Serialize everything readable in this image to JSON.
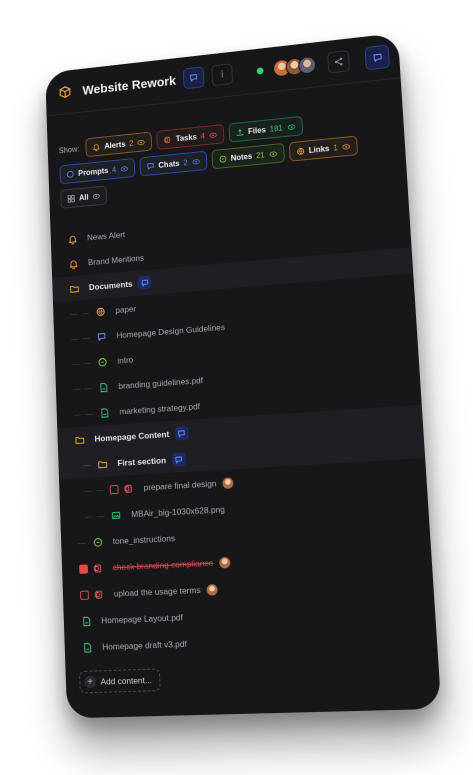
{
  "header": {
    "title": "Website Rework"
  },
  "filters": {
    "show_label": "Show:",
    "chips_row1": [
      {
        "label": "Alerts",
        "count": "2",
        "color": "#f2a33c"
      },
      {
        "label": "Tasks",
        "count": "4",
        "color": "#ef5a5a"
      },
      {
        "label": "Files",
        "count": "181",
        "color": "#3bd07a"
      }
    ],
    "chips_row2": [
      {
        "label": "Prompts",
        "count": "4",
        "color": "#6f8cff"
      },
      {
        "label": "Chats",
        "count": "2",
        "color": "#6f8cff"
      },
      {
        "label": "Notes",
        "count": "21",
        "color": "#8fd84a"
      },
      {
        "label": "Links",
        "count": "1",
        "color": "#f2a33c"
      }
    ],
    "chip_all": {
      "label": "All"
    }
  },
  "tree": {
    "news_alert": "News Alert",
    "brand_mentions": "Brand Mentions",
    "documents": "Documents",
    "paper": "paper",
    "homepage_design_guidelines": "Homepage Design Guidelines",
    "intro": "intro",
    "branding_guidelines": "branding guidelines.pdf",
    "marketing_strategy": "marketing strategy.pdf",
    "homepage_content": "Homepage Content",
    "first_section": "First section",
    "prepare_final_design": "prepare final design",
    "mbair_image": "MBAir_big-1030x628.png",
    "tone_instructions": "tone_instructions",
    "check_branding": "check branding compliance",
    "upload_terms": "upload the usage terms",
    "homepage_layout": "Homepage Layout.pdf",
    "homepage_draft": "Homepage draft v3.pdf"
  },
  "actions": {
    "add_content": "Add content..."
  }
}
